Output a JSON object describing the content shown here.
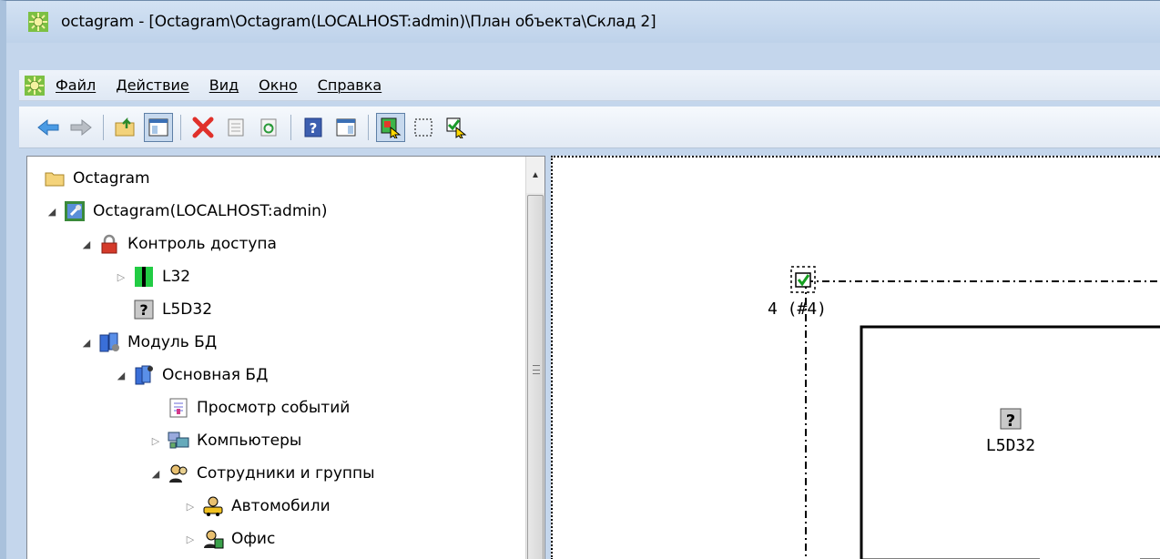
{
  "window": {
    "title": "octagram - [Octagram\\Octagram(LOCALHOST:admin)\\План объекта\\Склад 2]"
  },
  "menu": {
    "items": [
      {
        "label": "Файл",
        "name": "menu-file"
      },
      {
        "label": "Действие",
        "name": "menu-action"
      },
      {
        "label": "Вид",
        "name": "menu-view"
      },
      {
        "label": "Окно",
        "name": "menu-window"
      },
      {
        "label": "Справка",
        "name": "menu-help"
      }
    ]
  },
  "toolbar": {
    "buttons": [
      {
        "icon": "back-arrow-icon"
      },
      {
        "icon": "forward-arrow-icon"
      },
      {
        "icon": "up-folder-icon"
      },
      {
        "icon": "show-hide-tree-icon",
        "pressed": true
      },
      {
        "icon": "delete-icon"
      },
      {
        "icon": "properties-icon"
      },
      {
        "icon": "refresh-icon"
      },
      {
        "icon": "help-icon"
      },
      {
        "icon": "details-view-icon"
      },
      {
        "icon": "select-tool-icon",
        "pressed": true
      },
      {
        "icon": "selection-rect-icon"
      },
      {
        "icon": "edit-object-icon"
      }
    ]
  },
  "tree": {
    "items": [
      {
        "label": "Octagram",
        "icon": "folder-icon",
        "level": 0,
        "arrow": ""
      },
      {
        "label": "Octagram(LOCALHOST:admin)",
        "icon": "server-icon",
        "level": 1,
        "arrow": "expanded"
      },
      {
        "label": "Контроль доступа",
        "icon": "lock-icon",
        "level": 2,
        "arrow": "expanded"
      },
      {
        "label": "L32",
        "icon": "controller-icon",
        "level": 3,
        "arrow": "collapsed"
      },
      {
        "label": "L5D32",
        "icon": "unknown-device-icon",
        "level": 3,
        "arrow": ""
      },
      {
        "label": "Модуль БД",
        "icon": "database-module-icon",
        "level": 2,
        "arrow": "expanded"
      },
      {
        "label": "Основная БД",
        "icon": "database-icon",
        "level": 3,
        "arrow": "expanded"
      },
      {
        "label": "Просмотр событий",
        "icon": "event-log-icon",
        "level": 4,
        "arrow": ""
      },
      {
        "label": "Компьютеры",
        "icon": "computers-icon",
        "level": 4,
        "arrow": "collapsed"
      },
      {
        "label": "Сотрудники и группы",
        "icon": "people-icon",
        "level": 4,
        "arrow": "expanded"
      },
      {
        "label": "Автомобили",
        "icon": "car-group-icon",
        "level": 5,
        "arrow": "collapsed"
      },
      {
        "label": "Офис",
        "icon": "office-group-icon",
        "level": 5,
        "arrow": "collapsed"
      }
    ]
  },
  "plan": {
    "door_label": "4 (#4)",
    "device_label": "L5D32",
    "device_icon": "unknown-device-icon",
    "door_icon": "door-checked-icon"
  }
}
